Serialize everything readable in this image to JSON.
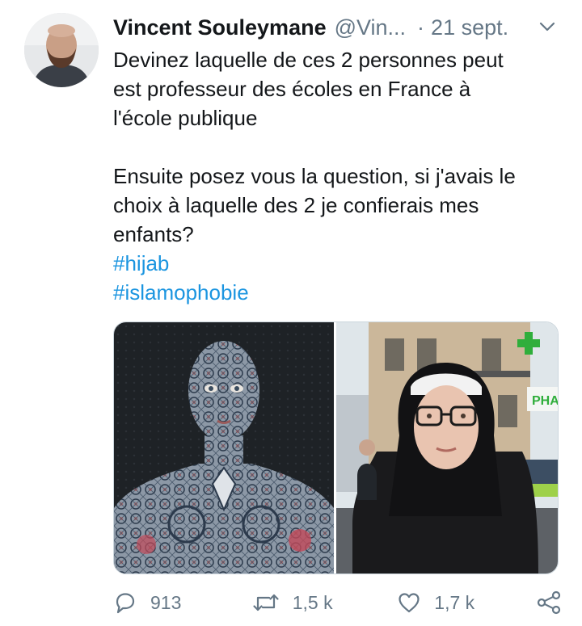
{
  "author": {
    "name": "Vincent Souleymane",
    "handle": "@Vin...",
    "separator": "·",
    "date": "21 sept."
  },
  "tweet": {
    "paragraph1_lines": [
      "Devinez laquelle de ces 2 personnes peut",
      "est professeur des écoles en France à",
      "l'école publique"
    ],
    "paragraph2_lines": [
      "Ensuite posez vous la question, si j'avais le",
      "choix à laquelle des 2 je confierais mes",
      "enfants?"
    ],
    "hashtags": [
      "#hijab",
      "#islamophobie"
    ]
  },
  "media": {
    "photo_left_sign_text": "",
    "photo_right_sign_text": "PHA"
  },
  "actions": {
    "reply_count": "913",
    "retweet_count": "1,5 k",
    "like_count": "1,7 k"
  },
  "icons": {
    "reply": "reply-icon",
    "retweet": "retweet-icon",
    "like": "heart-icon",
    "share": "share-icon",
    "menu": "chevron-down-icon"
  },
  "colors": {
    "link": "#1b95e0",
    "secondary_text": "#657786",
    "primary_text": "#14171a",
    "border": "#ccd6dd",
    "pharmacy_green": "#2fae3b"
  }
}
